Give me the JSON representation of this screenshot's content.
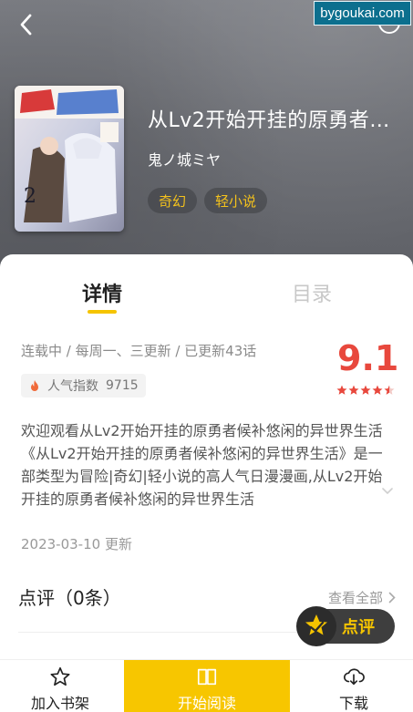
{
  "watermark": "bygoukai.com",
  "book": {
    "title": "从Lv2开始开挂的原勇者…",
    "author": "鬼ノ城ミヤ",
    "tags": [
      "奇幻",
      "轻小说"
    ],
    "cover_icon": "book-cover-image"
  },
  "tabs": {
    "detail": "详情",
    "catalog": "目录"
  },
  "info": {
    "status": "连载中 / 每周一、三更新 / 已更新43话",
    "popularity_label": "人气指数",
    "popularity_value": "9715",
    "score": "9.1",
    "stars": 4.5,
    "description": "欢迎观看从Lv2开始开挂的原勇者候补悠闲的异世界生活《从Lv2开始开挂的原勇者候补悠闲的异世界生活》是一部类型为冒险|奇幻|轻小说的高人气日漫漫画,从Lv2开始开挂的原勇者候补悠闲的异世界生活",
    "update_date": "2023-03-10 更新"
  },
  "reviews": {
    "title": "点评（0条）",
    "view_all": "查看全部",
    "fab_label": "点评"
  },
  "bottom_bar": {
    "shelf": "加入书架",
    "read": "开始阅读",
    "download": "下载"
  },
  "colors": {
    "accent": "#f5c400",
    "score": "#e8483d",
    "tag_text": "#f4c21c"
  }
}
